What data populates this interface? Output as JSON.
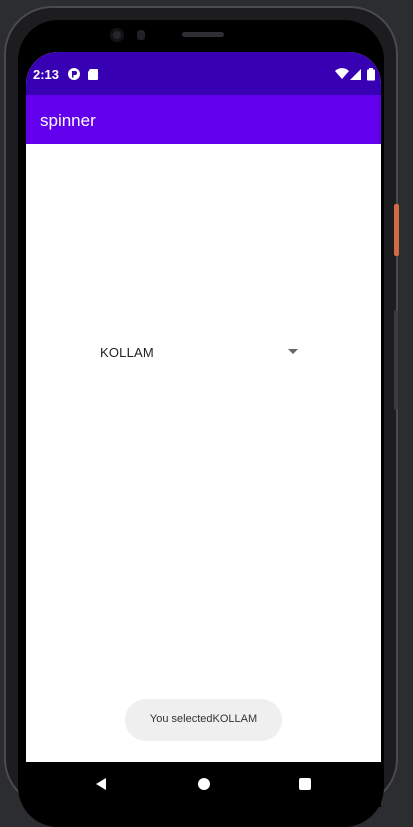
{
  "status_bar": {
    "time": "2:13",
    "icons": [
      "notification-app-icon",
      "sd-card-icon",
      "wifi-icon",
      "cell-signal-icon",
      "battery-icon"
    ]
  },
  "app_bar": {
    "title": "spinner"
  },
  "spinner": {
    "selected_value": "KOLLAM"
  },
  "toast": {
    "message": "You selectedKOLLAM"
  },
  "nav_bar": {
    "buttons": [
      "back-icon",
      "home-icon",
      "recents-icon"
    ]
  },
  "colors": {
    "status_bar": "#3700b3",
    "app_bar": "#6200ee",
    "content_bg": "#ffffff",
    "toast_bg": "#efefef"
  }
}
